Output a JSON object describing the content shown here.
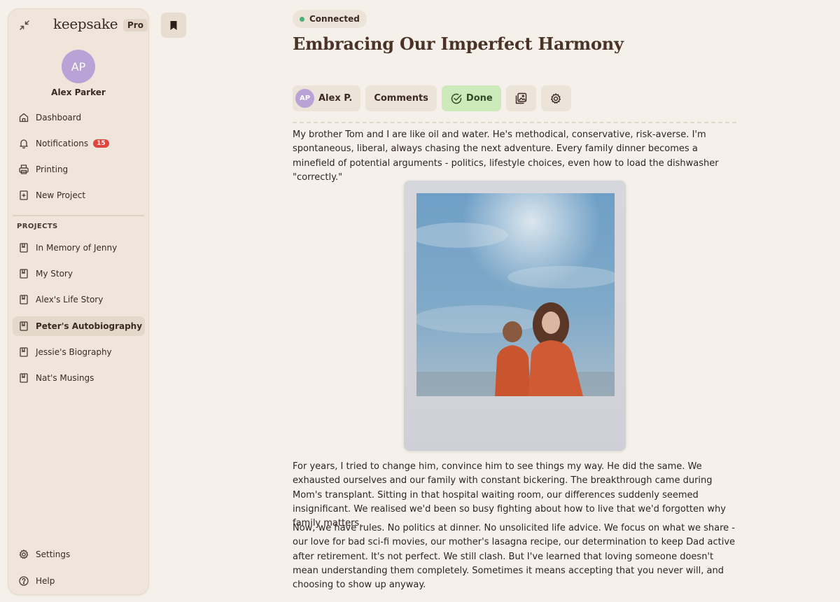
{
  "sidebar": {
    "brand": "keepsake",
    "plan_badge": "Pro",
    "user": {
      "initials": "AP",
      "name": "Alex Parker"
    },
    "nav": [
      {
        "label": "Dashboard",
        "icon": "home-icon"
      },
      {
        "label": "Notifications",
        "icon": "bell-icon",
        "badge": "15"
      },
      {
        "label": "Printing",
        "icon": "printer-icon"
      },
      {
        "label": "New Project",
        "icon": "plus-square-icon"
      }
    ],
    "projects_heading": "PROJECTS",
    "projects": [
      {
        "label": "In Memory of Jenny",
        "icon": "book-icon"
      },
      {
        "label": "My Story",
        "icon": "book-icon"
      },
      {
        "label": "Alex's Life Story",
        "icon": "book-icon"
      },
      {
        "label": "Peter's Autobiography",
        "icon": "book-icon",
        "active": true
      },
      {
        "label": "Jessie's Biography",
        "icon": "book-icon"
      },
      {
        "label": "Nat's Musings",
        "icon": "book-icon"
      }
    ],
    "footer": [
      {
        "label": "Settings",
        "icon": "gear-icon"
      },
      {
        "label": "Help",
        "icon": "help-icon"
      }
    ]
  },
  "status": {
    "label": "Connected",
    "color": "#4caf7a"
  },
  "document": {
    "title": "Embracing Our Imperfect Harmony",
    "toolbar": {
      "author_initials": "AP",
      "author_name": "Alex P.",
      "comments_label": "Comments",
      "done_label": "Done"
    },
    "paragraphs": [
      "My brother Tom and I are like oil and water. He's methodical, conservative, risk-averse. I'm spontaneous, liberal, always chasing the next adventure. Every family dinner becomes a minefield of potential arguments - politics, lifestyle choices, even how to load the dishwasher \"correctly.\"",
      "For years, I tried to change him, convince him to see things my way. He did the same. We exhausted ourselves and our family with constant bickering. The breakthrough came during Mom's transplant. Sitting in that hospital waiting room, our differences suddenly seemed insignificant. We realised we'd been so busy fighting about how to live that we'd forgotten why family matters.",
      "Now, we have rules. No politics at dinner. No unsolicited life advice. We focus on what we share - our love for bad sci-fi movies, our mother's lasagna recipe, our determination to keep Dad active after retirement. It's not perfect. We still clash. But I've learned that loving someone doesn't mean understanding them completely. Sometimes it means accepting that you never will, and choosing to show up anyway."
    ]
  },
  "colors": {
    "background": "#f5f0ea",
    "sidebar": "#efe5db",
    "avatar": "#b9a3d6",
    "done_button": "#cdeaba",
    "notification_badge": "#e0443a"
  }
}
